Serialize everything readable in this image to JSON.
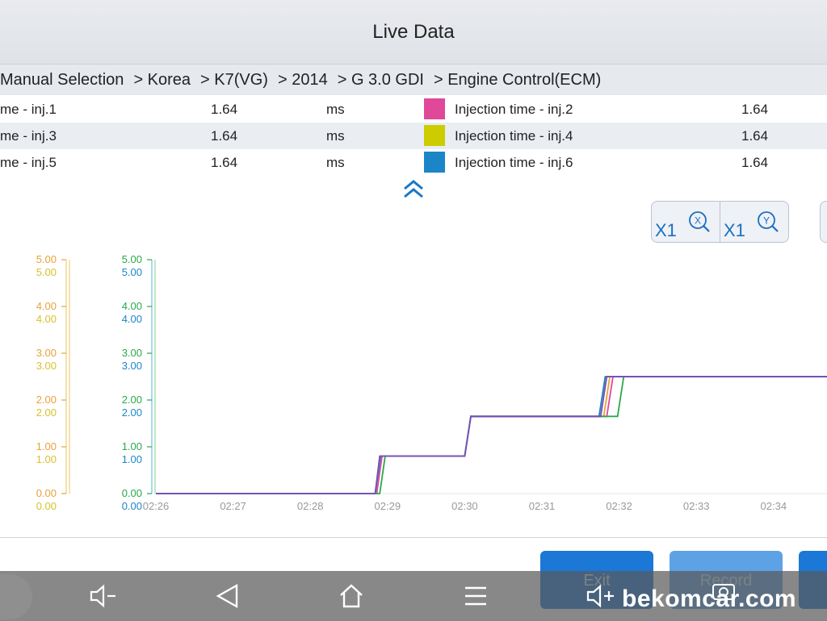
{
  "header": {
    "title": "Live Data"
  },
  "breadcrumb": [
    "Manual Selection",
    "> Korea",
    "> K7(VG)",
    "> 2014",
    "> G 3.0 GDI",
    "> Engine Control(ECM)"
  ],
  "params": [
    {
      "left_name": "me - inj.1",
      "left_value": "1.64",
      "unit": "ms",
      "swatch": "#e0489a",
      "right_name": "Injection time - inj.2",
      "right_value": "1.64"
    },
    {
      "left_name": "me - inj.3",
      "left_value": "1.64",
      "unit": "ms",
      "swatch": "#cccc00",
      "right_name": "Injection time - inj.4",
      "right_value": "1.64"
    },
    {
      "left_name": "me - inj.5",
      "left_value": "1.64",
      "unit": "ms",
      "swatch": "#1a86c8",
      "right_name": "Injection time - inj.6",
      "right_value": "1.64"
    }
  ],
  "zoom": {
    "x_label": "X1",
    "y_label": "X1"
  },
  "buttons": {
    "exit": "Exit",
    "record": "Record"
  },
  "navbar": {
    "icons": [
      "volume-down-icon",
      "back-icon",
      "home-icon",
      "menu-icon",
      "volume-up-icon",
      "screenshot-icon"
    ],
    "volume_down_label": "◁-"
  },
  "watermark": "bekomcar.com",
  "chart_data": {
    "type": "line",
    "x": [
      "02:26",
      "02:27",
      "02:28",
      "02:29",
      "02:30",
      "02:31",
      "02:32",
      "02:33",
      "02:34"
    ],
    "ylim": [
      0,
      5
    ],
    "axis_ticks": [
      "0.00",
      "1.00",
      "2.00",
      "3.00",
      "4.00",
      "5.00"
    ],
    "series": [
      {
        "color": "#e8a23a",
        "points": [
          [
            0,
            0
          ],
          [
            2.86,
            0
          ],
          [
            2.91,
            0.8
          ],
          [
            4.0,
            0.8
          ],
          [
            4.08,
            1.65
          ],
          [
            5.8,
            1.65
          ],
          [
            5.88,
            2.5
          ],
          [
            8.8,
            2.5
          ]
        ]
      },
      {
        "color": "#c9c936",
        "points": [
          [
            0,
            0
          ],
          [
            2.86,
            0
          ],
          [
            2.9,
            0.8
          ],
          [
            4.0,
            0.8
          ],
          [
            4.08,
            1.65
          ],
          [
            5.76,
            1.65
          ],
          [
            5.84,
            2.5
          ],
          [
            8.8,
            2.5
          ]
        ]
      },
      {
        "color": "#e0489a",
        "points": [
          [
            0,
            0
          ],
          [
            2.86,
            0
          ],
          [
            2.93,
            0.8
          ],
          [
            4.0,
            0.8
          ],
          [
            4.08,
            1.65
          ],
          [
            5.84,
            1.65
          ],
          [
            5.92,
            2.5
          ],
          [
            8.8,
            2.5
          ]
        ]
      },
      {
        "color": "#2aa84a",
        "points": [
          [
            0,
            0
          ],
          [
            2.9,
            0
          ],
          [
            2.97,
            0.8
          ],
          [
            4.0,
            0.8
          ],
          [
            4.08,
            1.65
          ],
          [
            5.98,
            1.65
          ],
          [
            6.06,
            2.5
          ],
          [
            8.8,
            2.5
          ]
        ]
      },
      {
        "color": "#1a86c8",
        "points": [
          [
            0,
            0
          ],
          [
            2.84,
            0
          ],
          [
            2.91,
            0.8
          ],
          [
            4.0,
            0.8
          ],
          [
            4.08,
            1.65
          ],
          [
            5.74,
            1.65
          ],
          [
            5.82,
            2.5
          ],
          [
            8.8,
            2.5
          ]
        ]
      },
      {
        "color": "#7a4db8",
        "points": [
          [
            0,
            0
          ],
          [
            2.84,
            0
          ],
          [
            2.9,
            0.8
          ],
          [
            4.0,
            0.8
          ],
          [
            4.08,
            1.65
          ],
          [
            5.76,
            1.65
          ],
          [
            5.84,
            2.5
          ],
          [
            8.8,
            2.5
          ]
        ]
      }
    ]
  }
}
